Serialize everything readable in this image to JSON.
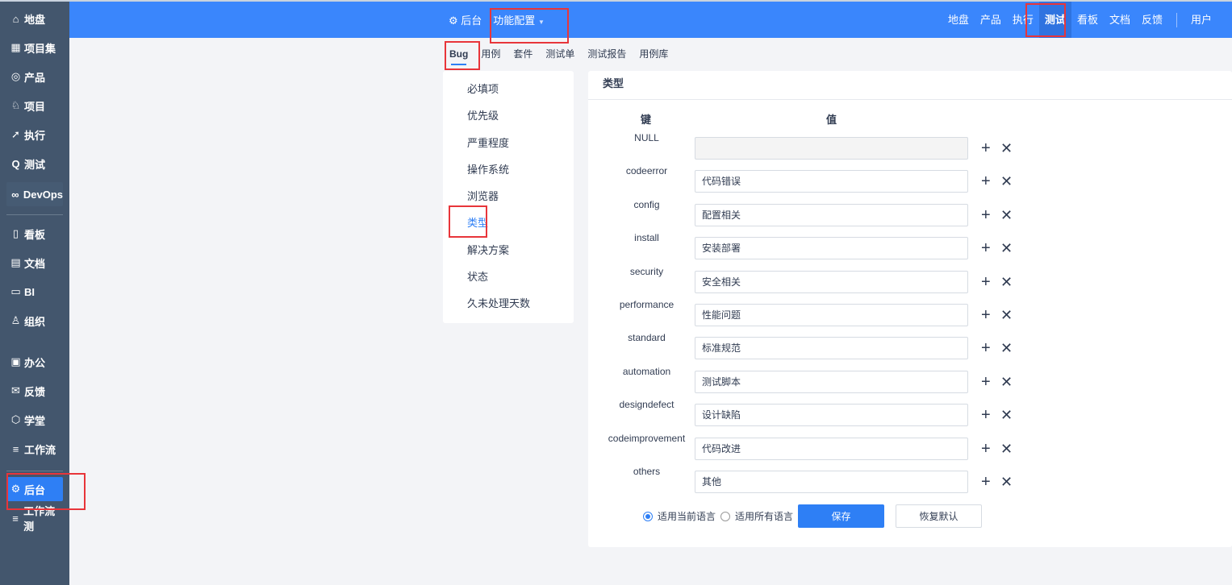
{
  "sidebar": {
    "items": [
      {
        "label": "地盘",
        "icon": "⌂",
        "name": "home"
      },
      {
        "label": "项目集",
        "icon": "▦",
        "name": "program"
      },
      {
        "label": "产品",
        "icon": "◎",
        "name": "product"
      },
      {
        "label": "项目",
        "icon": "♘",
        "name": "project"
      },
      {
        "label": "执行",
        "icon": "➚",
        "name": "execution"
      },
      {
        "label": "测试",
        "icon": "Q",
        "name": "qa"
      },
      {
        "label": "DevOps",
        "icon": "∞",
        "name": "devops"
      },
      {
        "label": "看板",
        "icon": "▯",
        "name": "kanban"
      },
      {
        "label": "文档",
        "icon": "▤",
        "name": "doc"
      },
      {
        "label": "BI",
        "icon": "▭",
        "name": "bi"
      },
      {
        "label": "组织",
        "icon": "♙",
        "name": "org"
      },
      {
        "label": "办公",
        "icon": "▣",
        "name": "oa"
      },
      {
        "label": "反馈",
        "icon": "✉",
        "name": "feedback"
      },
      {
        "label": "学堂",
        "icon": "⬡",
        "name": "academy"
      },
      {
        "label": "工作流",
        "icon": "≡",
        "name": "workflow"
      },
      {
        "label": "后台",
        "icon": "⚙",
        "name": "admin"
      },
      {
        "label": "工作流测",
        "icon": "≡",
        "name": "workflow-test"
      }
    ]
  },
  "topbar": {
    "admin": "后台",
    "section": "功能配置",
    "nav": [
      "地盘",
      "产品",
      "执行",
      "测试",
      "看板",
      "文档",
      "反馈"
    ],
    "user": "用户"
  },
  "subnav": [
    "Bug",
    "用例",
    "套件",
    "测试单",
    "测试报告",
    "用例库"
  ],
  "leftmenu": [
    "必填项",
    "优先级",
    "严重程度",
    "操作系统",
    "浏览器",
    "类型",
    "解决方案",
    "状态",
    "久未处理天数"
  ],
  "main": {
    "title": "类型",
    "key_header": "键",
    "value_header": "值",
    "rows": [
      {
        "key": "NULL",
        "value": ""
      },
      {
        "key": "codeerror",
        "value": "代码错误"
      },
      {
        "key": "config",
        "value": "配置相关"
      },
      {
        "key": "install",
        "value": "安装部署"
      },
      {
        "key": "security",
        "value": "安全相关"
      },
      {
        "key": "performance",
        "value": "性能问题"
      },
      {
        "key": "standard",
        "value": "标准规范"
      },
      {
        "key": "automation",
        "value": "测试脚本"
      },
      {
        "key": "designdefect",
        "value": "设计缺陷"
      },
      {
        "key": "codeimprovement",
        "value": "代码改进"
      },
      {
        "key": "others",
        "value": "其他"
      }
    ],
    "radio_current": "适用当前语言",
    "radio_all": "适用所有语言",
    "save": "保存",
    "reset": "恢复默认"
  },
  "colors": {
    "accent": "#2e7ff5",
    "sidebar": "#43566d",
    "topbar": "#3a86fc",
    "highlight": "#e8353a"
  }
}
